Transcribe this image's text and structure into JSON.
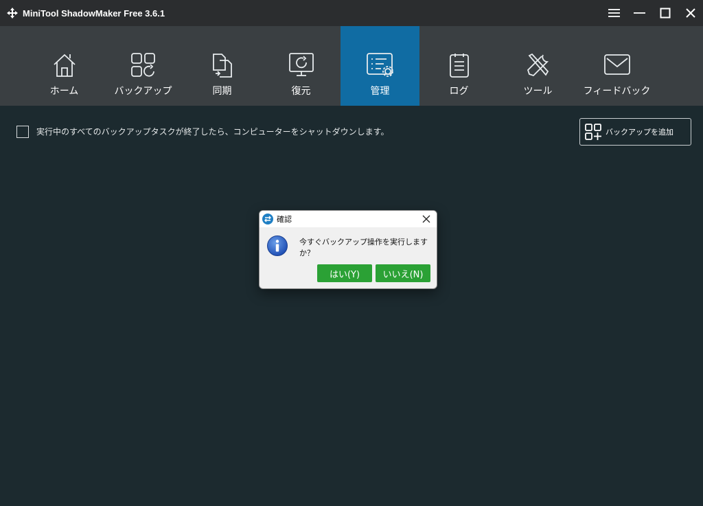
{
  "window": {
    "title": "MiniTool ShadowMaker Free 3.6.1",
    "logo_icon": "minitool-logo-icon",
    "controls": [
      "menu-icon",
      "minimize-icon",
      "maximize-icon",
      "close-icon"
    ]
  },
  "nav": {
    "items": [
      {
        "label": "ホーム",
        "icon": "home-icon"
      },
      {
        "label": "バックアップ",
        "icon": "backup-icon"
      },
      {
        "label": "同期",
        "icon": "sync-icon"
      },
      {
        "label": "復元",
        "icon": "restore-icon"
      },
      {
        "label": "管理",
        "icon": "manage-icon",
        "active": true
      },
      {
        "label": "ログ",
        "icon": "log-icon"
      },
      {
        "label": "ツール",
        "icon": "tools-icon"
      },
      {
        "label": "フィードバック",
        "icon": "feedback-icon"
      }
    ],
    "active_color": "#106ca3"
  },
  "main": {
    "shutdown_label": "実行中のすべてのバックアップタスクが終了したら、コンピューターをシャットダウンします。",
    "shutdown_checked": false,
    "add_backup_label": "バックアップを追加"
  },
  "dialog": {
    "title": "確認",
    "message": "今すぐバックアップ操作を実行しますか？",
    "yes_label": "はい(Y)",
    "no_label": "いいえ(N)",
    "button_color": "#2ba135",
    "icon": "info-icon"
  }
}
